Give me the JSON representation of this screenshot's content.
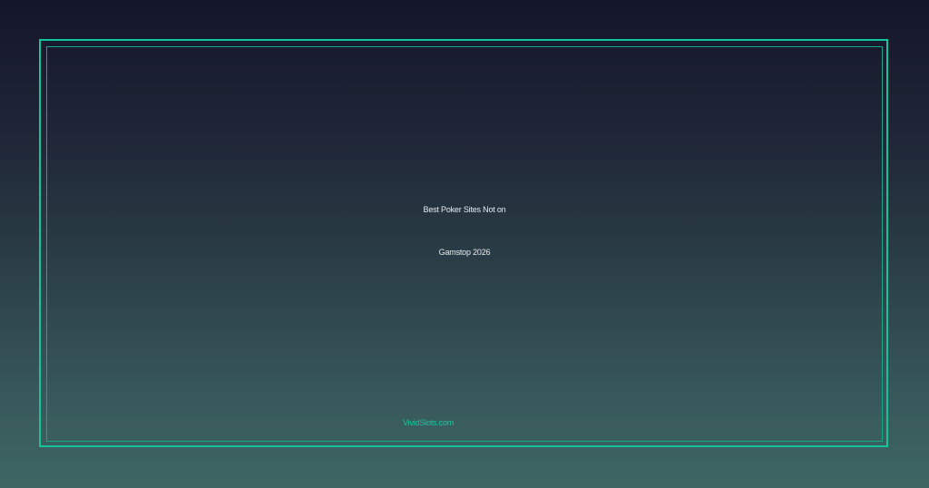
{
  "banner": {
    "title_line_1": "Best Poker Sites Not on",
    "title_line_2": "Gamstop 2026",
    "brand": "VividSlots.com"
  },
  "colors": {
    "accent": "#14c49a",
    "text": "#e6ebee",
    "background_top": "#141629",
    "background_bottom": "#3e6663"
  }
}
